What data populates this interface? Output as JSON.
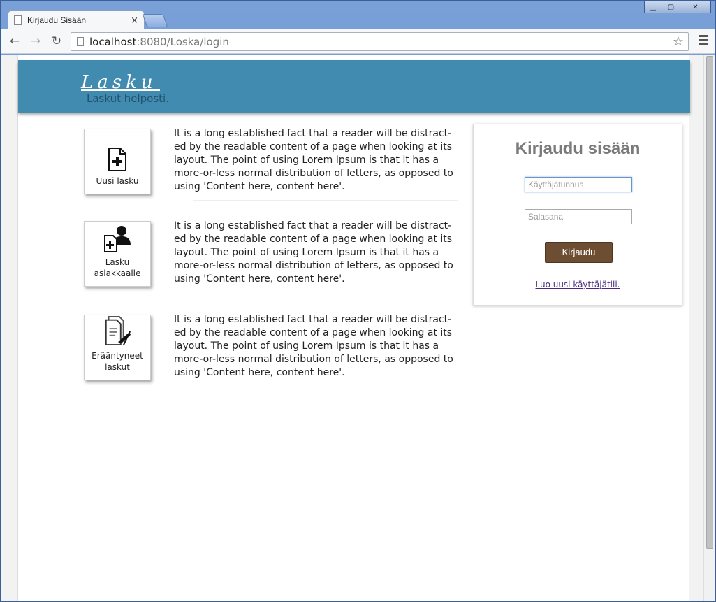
{
  "browser": {
    "tab_title": "Kirjaudu Sisään",
    "tab_close": "×",
    "url_host": "localhost",
    "url_rest": ":8080/Loska/login",
    "back": "←",
    "forward": "→",
    "reload": "↻",
    "star": "☆",
    "minimize": "▁",
    "maximize": "▢",
    "close": "✕"
  },
  "header": {
    "logo": "Lasku",
    "tagline": "Laskut helposti."
  },
  "features": [
    {
      "label": "Uusi lasku",
      "icon": "new-invoice-icon",
      "description": "It is a long established fact that a reader will be distract-ed by the readable content of a page when looking at its layout. The point of using Lorem Ipsum is that it has a more-or-less normal distribution of letters, as opposed to using 'Content here, content here'."
    },
    {
      "label": "Lasku asiakkaalle",
      "icon": "customer-invoice-icon",
      "description": "It is a long established fact that a reader will be distract-ed by the readable content of a page when looking at its layout. The point of using Lorem Ipsum is that it has a more-or-less normal distribution of letters, as opposed to using 'Content here, content here'."
    },
    {
      "label": "Erääntyneet laskut",
      "icon": "overdue-invoices-icon",
      "description": "It is a long established fact that a reader will be distract-ed by the readable content of a page when looking at its layout. The point of using Lorem Ipsum is that it has a more-or-less normal distribution of letters, as opposed to using 'Content here, content here'."
    }
  ],
  "login": {
    "title": "Kirjaudu sisään",
    "username_placeholder": "Käyttäjätunnus",
    "username_value": "",
    "password_placeholder": "Salasana",
    "password_value": "",
    "submit_label": "Kirjaudu",
    "register_link": "Luo uusi käyttäjätili."
  },
  "colors": {
    "header_bg": "#418ab0",
    "button_bg": "#6e4e33",
    "link": "#4a2a80"
  }
}
